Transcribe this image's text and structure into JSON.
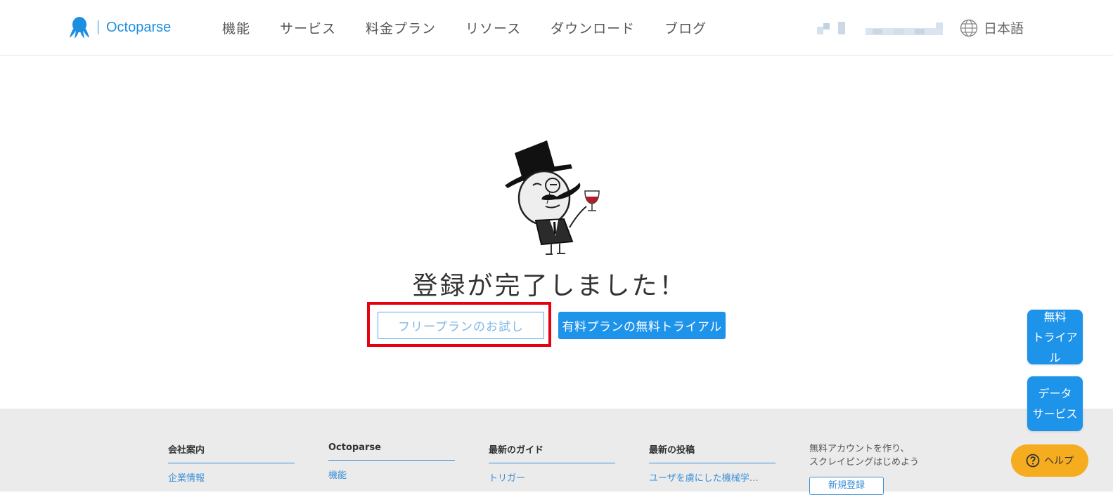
{
  "colors": {
    "accent": "#1e93ea",
    "highlight": "#e60012",
    "help": "#f5ac1f"
  },
  "header": {
    "logo_text": "Octoparse",
    "logo_icon": "octopus-icon",
    "nav": [
      {
        "label": "機能"
      },
      {
        "label": "サービス"
      },
      {
        "label": "料金プラン"
      },
      {
        "label": "リソース"
      },
      {
        "label": "ダウンロード"
      },
      {
        "label": "ブログ"
      }
    ],
    "language": {
      "icon": "globe-icon",
      "label": "日本語"
    }
  },
  "main": {
    "title": "登録が完了しました！",
    "free_button": "フリープランのお試し",
    "paid_button": "有料プランの無料トライアル"
  },
  "floating": {
    "trial": [
      "無料",
      "トライアル"
    ],
    "data_service": [
      "データ",
      "サービス"
    ],
    "help": {
      "icon": "question-circle-icon",
      "label": "ヘルプ"
    }
  },
  "footer": {
    "columns": [
      {
        "heading": "会社案内",
        "link": "企業情報"
      },
      {
        "heading": "Octoparse",
        "link": "機能"
      },
      {
        "heading": "最新のガイド",
        "link": "トリガー"
      },
      {
        "heading": "最新の投稿",
        "link": "ユーザを虜にした機械学…"
      }
    ],
    "cta_text_1": "無料アカウントを作り、",
    "cta_text_2": "スクレイピングはじめよう",
    "cta_button": "新規登録"
  }
}
